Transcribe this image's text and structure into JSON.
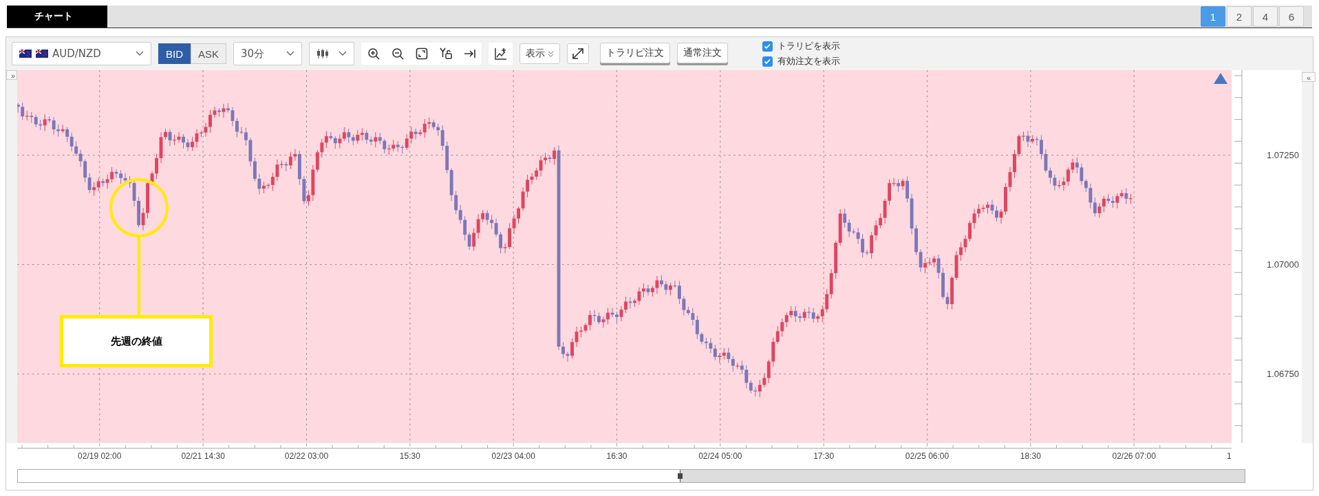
{
  "top_bar": {
    "tabs": [
      {
        "label": "チャート",
        "selected": true
      }
    ],
    "layout_buttons": [
      {
        "label": "1",
        "selected": true
      },
      {
        "label": "2",
        "selected": false
      },
      {
        "label": "4",
        "selected": false
      },
      {
        "label": "6",
        "selected": false
      }
    ]
  },
  "toolbar": {
    "symbol": "AUD/NZD",
    "price_side": [
      {
        "label": "BID",
        "selected": true
      },
      {
        "label": "ASK",
        "selected": false
      }
    ],
    "timeframe": "30分",
    "display_menu": "表示",
    "order_buttons": [
      "トラリピ注文",
      "通常注文"
    ],
    "checkboxes": [
      {
        "label": "トラリピを表示",
        "checked": true
      },
      {
        "label": "有効注文を表示",
        "checked": true
      }
    ]
  },
  "chart": {
    "left_toggle": "»",
    "right_toggle": "«",
    "y_axis_labels": [
      "1.07250",
      "1.07000",
      "1.06750"
    ],
    "x_axis_labels": [
      "02/19 02:00",
      "02/21 14:30",
      "02/22 03:00",
      "15:30",
      "02/23 04:00",
      "16:30",
      "02/24 05:00",
      "17:30",
      "02/25 06:00",
      "18:30",
      "02/26 07:00",
      "1"
    ],
    "annotation": "先週の終値"
  }
}
